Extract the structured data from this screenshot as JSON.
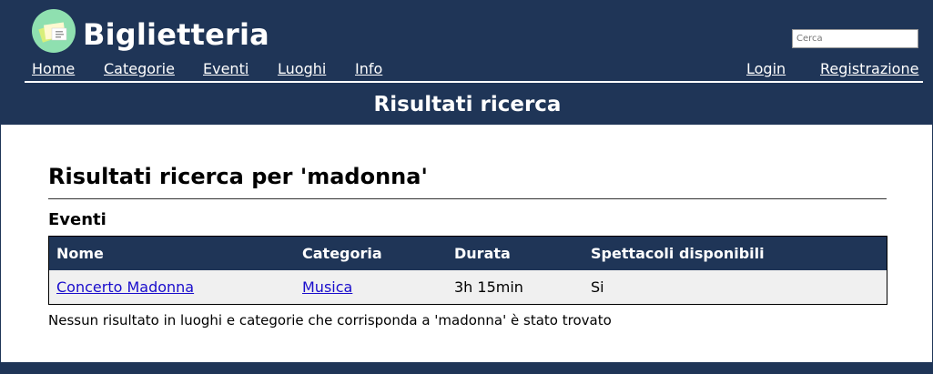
{
  "header": {
    "site_title": "Biglietteria",
    "logo_icon": "ticket-logo-icon",
    "search_placeholder": "Cerca",
    "nav_left": [
      "Home",
      "Categorie",
      "Eventi",
      "Luoghi",
      "Info"
    ],
    "nav_right": [
      "Login",
      "Registrazione"
    ],
    "page_heading": "Risultati ricerca"
  },
  "main": {
    "results_title": "Risultati ricerca per 'madonna'",
    "events_section_title": "Eventi",
    "table": {
      "headers": [
        "Nome",
        "Categoria",
        "Durata",
        "Spettacoli disponibili"
      ],
      "rows": [
        [
          "Concerto Madonna",
          "Musica",
          "3h 15min",
          "Si"
        ]
      ]
    },
    "no_results_message": "Nessun risultato in luoghi e categorie che corrisponda a 'madonna' è stato trovato"
  },
  "colors": {
    "brand_navy": "#1f3557",
    "logo_green": "#8fe0b0",
    "link_blue": "#1a0dcc",
    "row_background": "#f0f0f0"
  }
}
